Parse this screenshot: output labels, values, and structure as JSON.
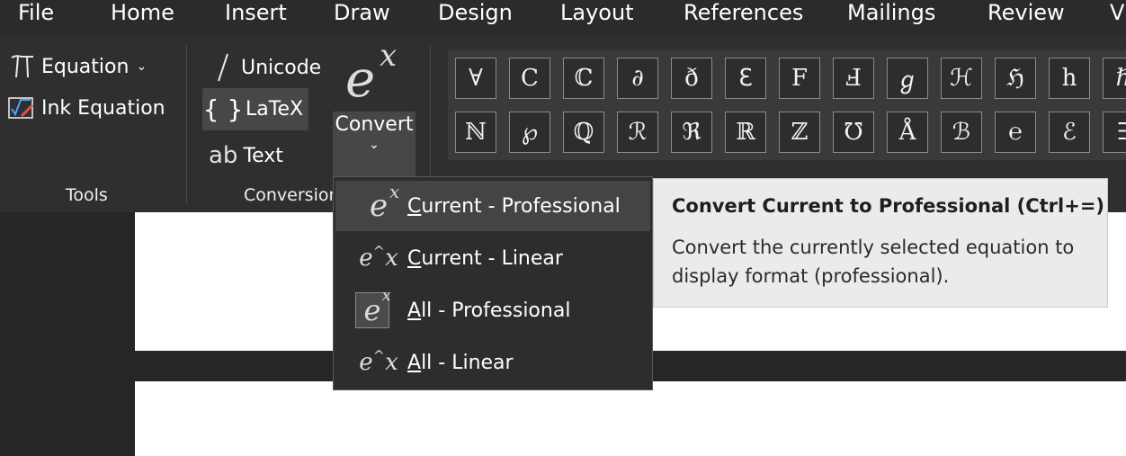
{
  "menubar": {
    "tabs": [
      "File",
      "Home",
      "Insert",
      "Draw",
      "Design",
      "Layout",
      "References",
      "Mailings",
      "Review",
      "V"
    ]
  },
  "ribbon": {
    "tools": {
      "equation_label": "Equation",
      "ink_equation_label": "Ink Equation",
      "group_label": "Tools"
    },
    "conversions": {
      "unicode_label": "Unicode",
      "latex_label": "LaTeX",
      "text_label": "Text",
      "convert_label": "Convert",
      "group_label": "Conversions"
    },
    "symbols_row1": [
      "∀",
      "C",
      "ℂ",
      "∂",
      "ð",
      "ℇ",
      "F",
      "Ⅎ",
      "ℊ",
      "ℋ",
      "ℌ",
      "h",
      "ℏ"
    ],
    "symbols_row2": [
      "ℕ",
      "℘",
      "ℚ",
      "ℛ",
      "ℜ",
      "ℝ",
      "ℤ",
      "℧",
      "Å",
      "ℬ",
      "℮",
      "ℰ",
      "∃"
    ]
  },
  "convert_menu": {
    "items": [
      {
        "accel": "C",
        "rest": "urrent - Professional"
      },
      {
        "accel": "C",
        "rest": "urrent - Linear"
      },
      {
        "accel": "A",
        "rest": "ll - Professional"
      },
      {
        "accel": "A",
        "rest": "ll - Linear"
      }
    ]
  },
  "tooltip": {
    "title": "Convert Current to Professional (Ctrl+=)",
    "body": "Convert the currently selected equation to display format (professional)."
  },
  "icons": {
    "equation": "pi-icon",
    "ink_equation": "ink-equation-icon",
    "unicode": "slash-icon",
    "latex": "braces-icon",
    "text": "ab-icon",
    "convert": "ex-icon"
  }
}
